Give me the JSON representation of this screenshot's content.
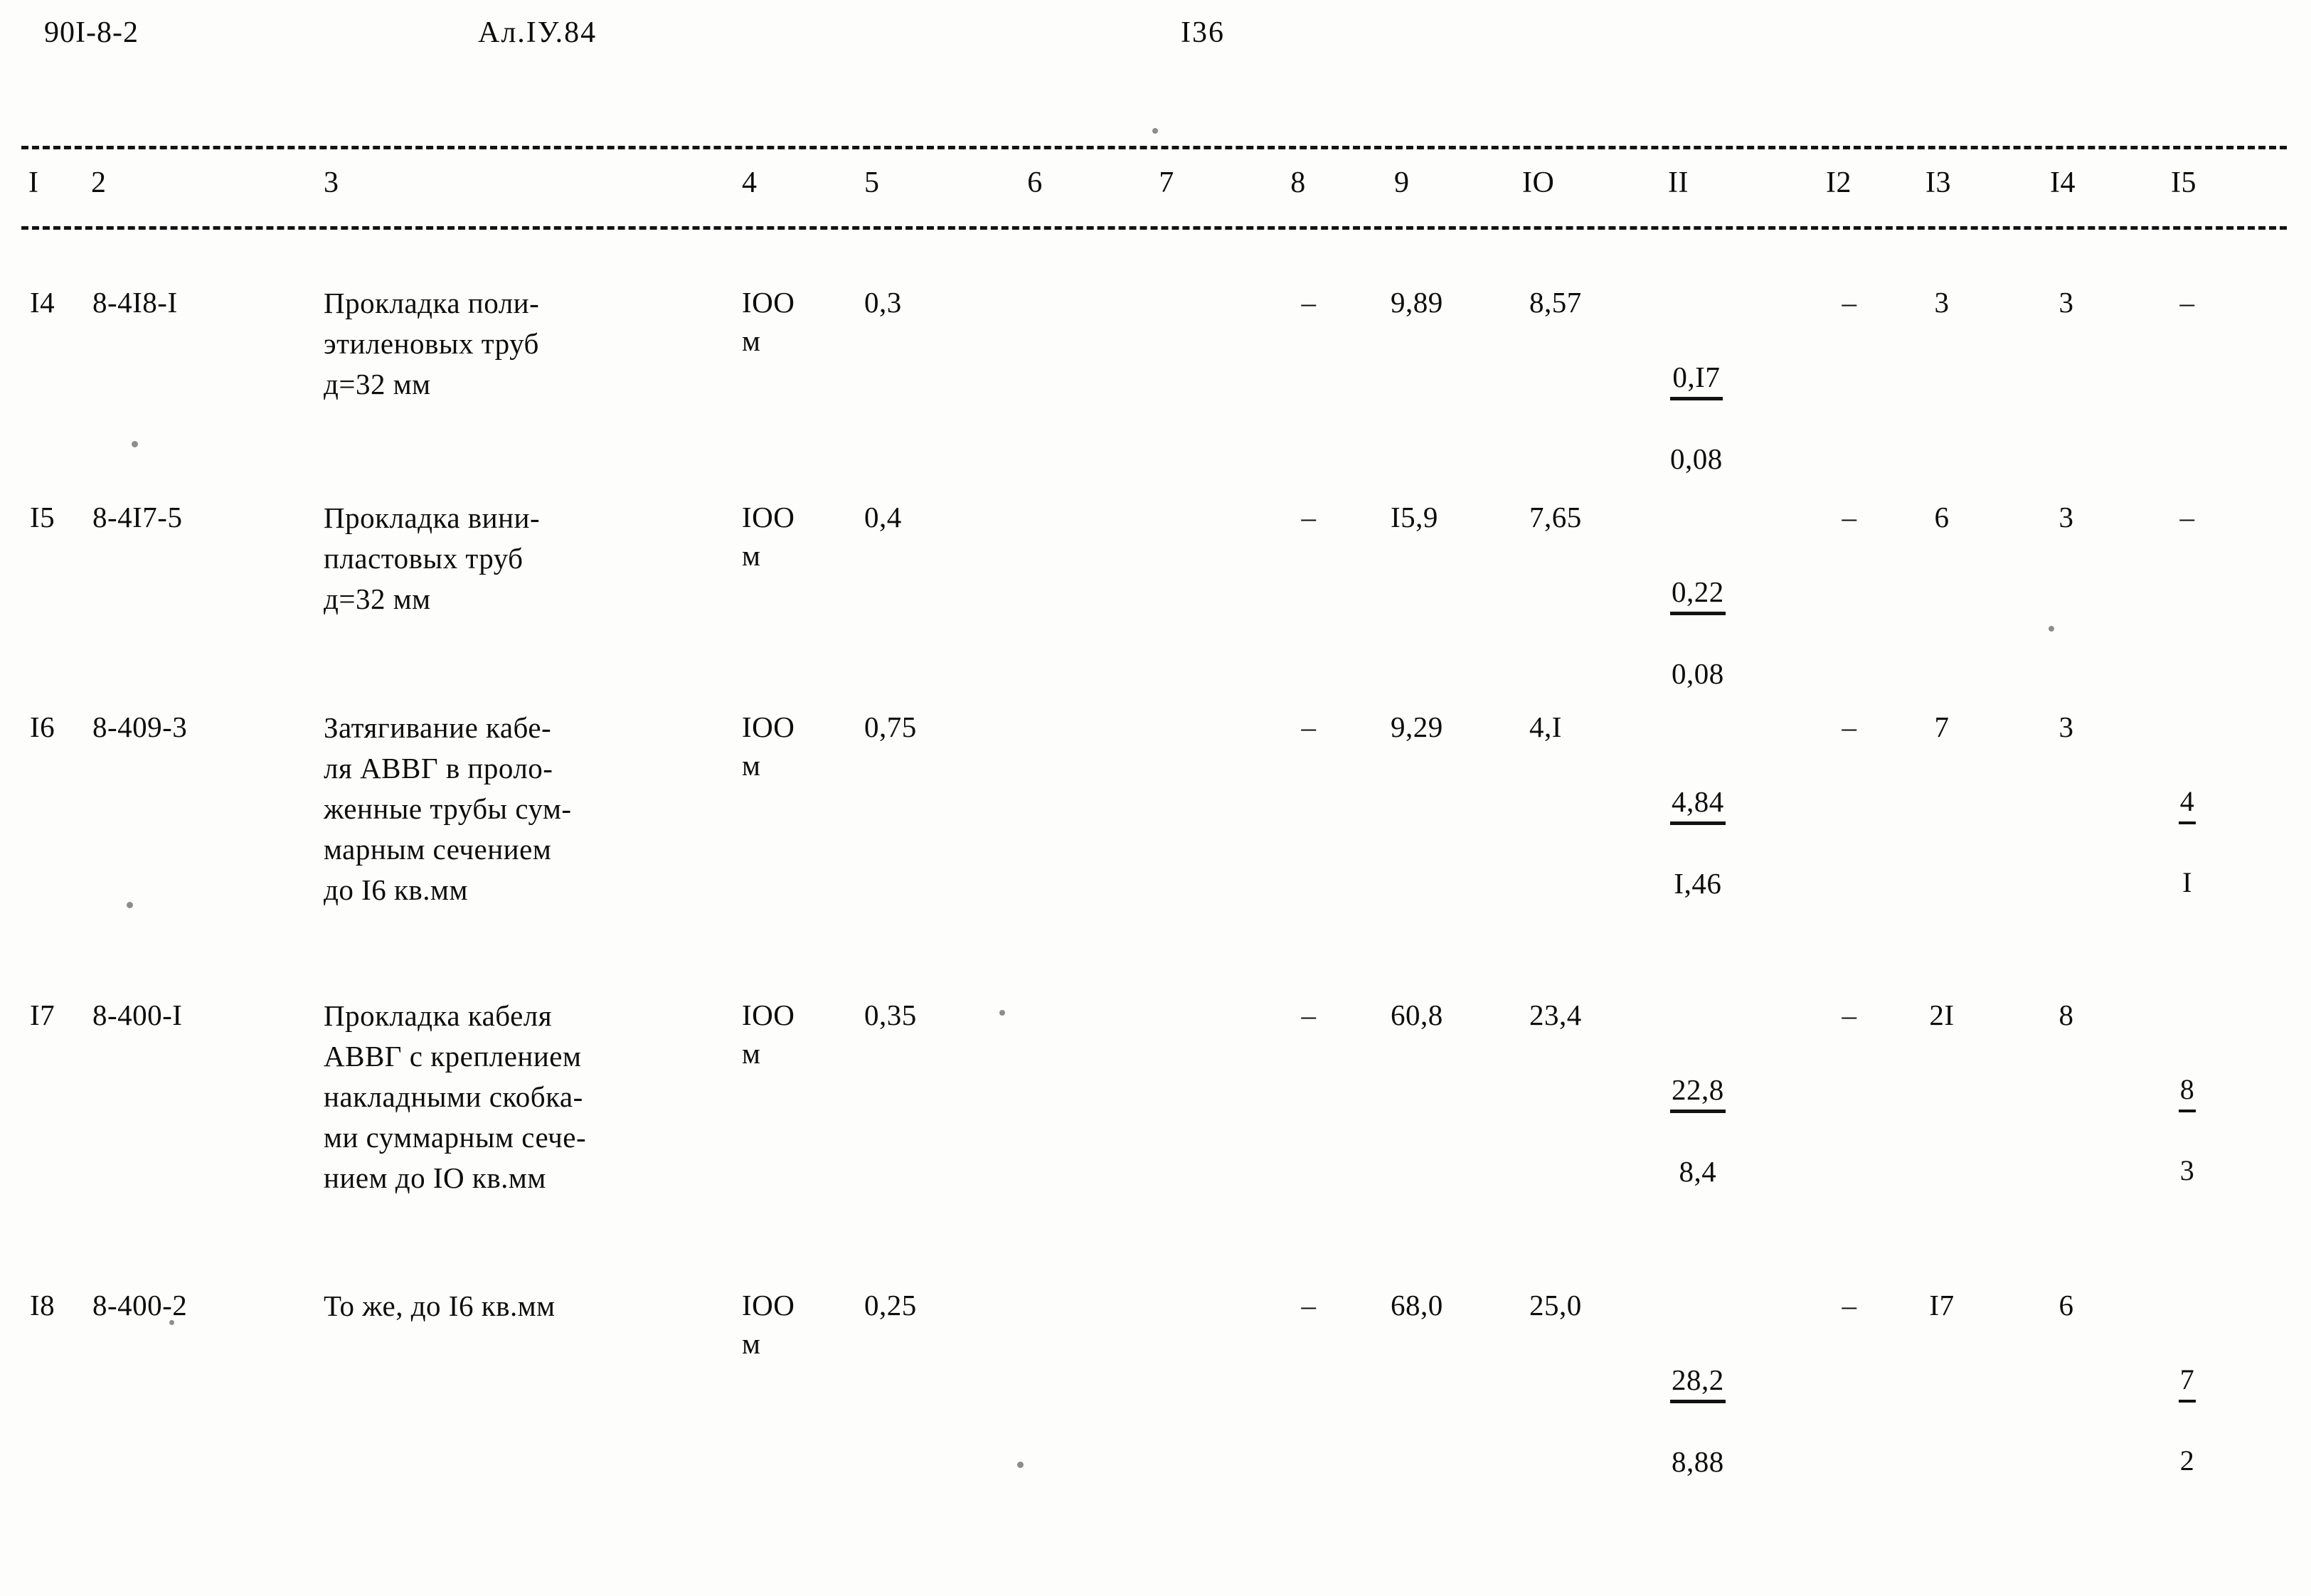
{
  "header": {
    "doc_code": "90I-8-2",
    "album": "Ал.IУ.84",
    "page_number": "I36"
  },
  "table": {
    "column_headers": [
      "I",
      "2",
      "3",
      "4",
      "5",
      "6",
      "7",
      "8",
      "9",
      "IO",
      "II",
      "I2",
      "I3",
      "I4",
      "I5"
    ],
    "rows": [
      {
        "c1": "I4",
        "c2": "8-4I8-I",
        "c3": "Прокладка поли-\nэтиленовых труб\nд=32 мм",
        "c4": "IOO\nм",
        "c5": "0,3",
        "c6": "",
        "c7": "",
        "c8": "–",
        "c9": "9,89",
        "c10": "8,57",
        "c11_num": "0,I7",
        "c11_den": "0,08",
        "c12": "–",
        "c13": "3",
        "c14": "3",
        "c15_num": "",
        "c15_den": "",
        "c15_plain": "–"
      },
      {
        "c1": "I5",
        "c2": "8-4I7-5",
        "c3": "Прокладка вини-\nпластовых труб\nд=32 мм",
        "c4": "IOO\nм",
        "c5": "0,4",
        "c6": "",
        "c7": "",
        "c8": "–",
        "c9": "I5,9",
        "c10": "7,65",
        "c11_num": "0,22",
        "c11_den": "0,08",
        "c12": "–",
        "c13": "6",
        "c14": "3",
        "c15_num": "",
        "c15_den": "",
        "c15_plain": "–"
      },
      {
        "c1": "I6",
        "c2": "8-409-3",
        "c3": "Затягивание кабе-\nля АВВГ в проло-\nженные трубы сум-\nмарным сечением\nдо I6 кв.мм",
        "c4": "IOO\nм",
        "c5": "0,75",
        "c6": "",
        "c7": "",
        "c8": "–",
        "c9": "9,29",
        "c10": "4,I",
        "c11_num": "4,84",
        "c11_den": "I,46",
        "c12": "–",
        "c13": "7",
        "c14": "3",
        "c15_num": "4",
        "c15_den": "I",
        "c15_plain": ""
      },
      {
        "c1": "I7",
        "c2": "8-400-I",
        "c3": "Прокладка кабеля\nАВВГ с креплением\nнакладными скобка-\nми суммарным сече-\nнием до IO кв.мм",
        "c4": "IOO\nм",
        "c5": "0,35",
        "c6": "",
        "c7": "",
        "c8": "–",
        "c9": "60,8",
        "c10": "23,4",
        "c11_num": "22,8",
        "c11_den": "8,4",
        "c12": "–",
        "c13": "2I",
        "c14": "8",
        "c15_num": "8",
        "c15_den": "3",
        "c15_plain": ""
      },
      {
        "c1": "I8",
        "c2": "8-400-2",
        "c3": "То же, до I6 кв.мм",
        "c4": "IOO\nм",
        "c5": "0,25",
        "c6": "",
        "c7": "",
        "c8": "–",
        "c9": "68,0",
        "c10": "25,0",
        "c11_num": "28,2",
        "c11_den": "8,88",
        "c12": "–",
        "c13": "I7",
        "c14": "6",
        "c15_num": "7",
        "c15_den": "2",
        "c15_plain": ""
      }
    ]
  }
}
